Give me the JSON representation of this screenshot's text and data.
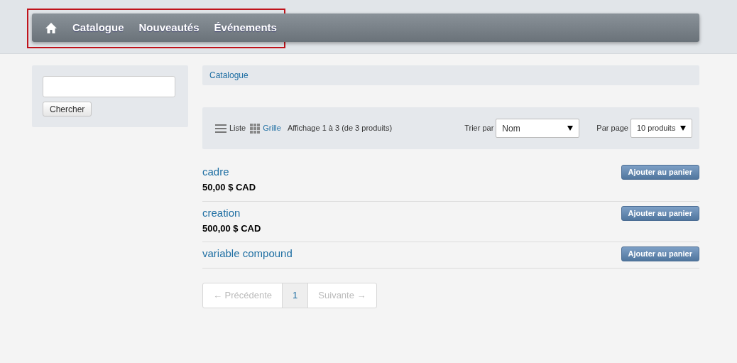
{
  "nav": {
    "items": [
      {
        "kind": "home"
      },
      {
        "kind": "link",
        "label": "Catalogue"
      },
      {
        "kind": "link",
        "label": "Nouveautés"
      },
      {
        "kind": "link",
        "label": "Événements"
      }
    ],
    "highlighted": true
  },
  "sidebar": {
    "search_button": "Chercher"
  },
  "breadcrumb": "Catalogue",
  "toolbar": {
    "views": [
      {
        "kind": "list",
        "label": "Liste",
        "selected": true
      },
      {
        "kind": "grid",
        "label": "Grille",
        "selected": false
      }
    ],
    "summary": "Affichage 1 à 3 (de 3 produits)",
    "sort": {
      "label": "Trier par",
      "value": "Nom"
    },
    "per_page": {
      "label": "Par page",
      "value": "10 produits"
    }
  },
  "products": [
    {
      "name": "cadre",
      "price": "50,00 $ CAD",
      "button": "Ajouter au panier"
    },
    {
      "name": "creation",
      "price": "500,00 $ CAD",
      "button": "Ajouter au panier"
    },
    {
      "name": "variable compound",
      "button": "Ajouter au panier"
    }
  ],
  "pagination": [
    {
      "label": "← Précédente",
      "disabled": true,
      "selected": false
    },
    {
      "label": "1",
      "disabled": false,
      "selected": true
    },
    {
      "label": "Suivante →",
      "disabled": true,
      "selected": false
    }
  ]
}
